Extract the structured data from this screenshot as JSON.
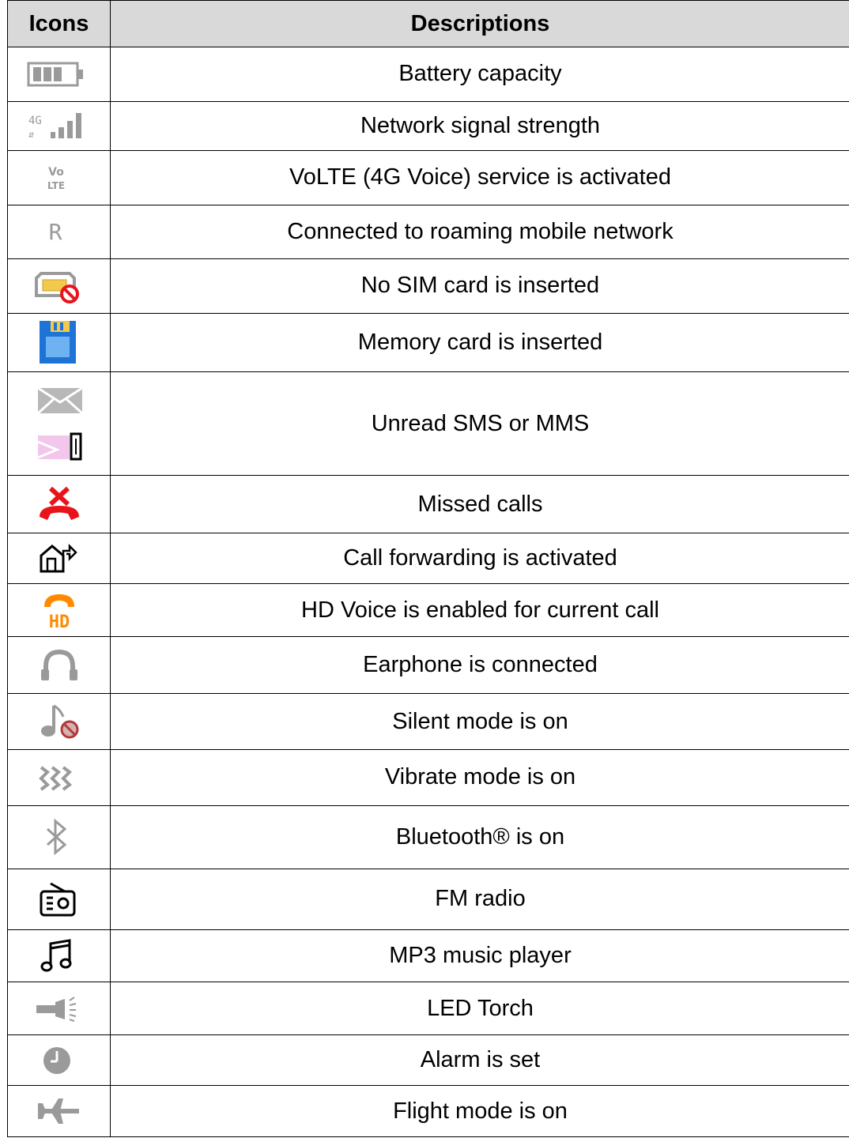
{
  "table": {
    "headers": {
      "icons": "Icons",
      "descriptions": "Descriptions"
    },
    "rows": [
      {
        "icon": "battery-icon",
        "description": "Battery capacity"
      },
      {
        "icon": "signal-strength-icon",
        "description": "Network signal strength"
      },
      {
        "icon": "volte-icon",
        "description": "VoLTE (4G Voice) service is activated"
      },
      {
        "icon": "roaming-icon",
        "description": "Connected to roaming mobile network"
      },
      {
        "icon": "no-sim-icon",
        "description": "No SIM card is inserted"
      },
      {
        "icon": "memory-card-icon",
        "description": "Memory card is inserted"
      },
      {
        "icon": "sms-mms-icon",
        "description": "Unread SMS or MMS"
      },
      {
        "icon": "missed-call-icon",
        "description": "Missed calls"
      },
      {
        "icon": "call-forwarding-icon",
        "description": "Call forwarding is activated"
      },
      {
        "icon": "hd-voice-icon",
        "description": "HD Voice is enabled for current call"
      },
      {
        "icon": "earphone-icon",
        "description": "Earphone is connected"
      },
      {
        "icon": "silent-mode-icon",
        "description": "Silent mode is on"
      },
      {
        "icon": "vibrate-icon",
        "description": "Vibrate mode is on"
      },
      {
        "icon": "bluetooth-icon",
        "description": "Bluetooth® is on"
      },
      {
        "icon": "fm-radio-icon",
        "description": "FM radio"
      },
      {
        "icon": "music-player-icon",
        "description": "MP3 music player"
      },
      {
        "icon": "torch-icon",
        "description": "LED Torch"
      },
      {
        "icon": "alarm-icon",
        "description": "Alarm is set"
      },
      {
        "icon": "flight-mode-icon",
        "description": "Flight mode is on"
      }
    ],
    "icon_labels": {
      "signal_network": "4G",
      "volte_top": "Vo",
      "volte_bottom": "LTE",
      "roaming": "R",
      "hd": "HD"
    }
  },
  "colors": {
    "header_bg": "#d9d9d9",
    "icon_gray": "#9a9a9a",
    "missed_call_red": "#e8141a",
    "hd_orange": "#ff8a00",
    "memory_blue": "#1d74d6",
    "sim_yellow": "#f2c94c",
    "mms_pink": "#f3c6ec"
  }
}
